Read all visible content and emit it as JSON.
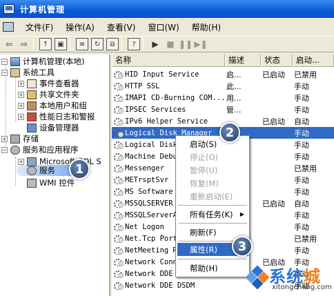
{
  "window": {
    "title": "计算机管理"
  },
  "menu": [
    "文件(F)",
    "操作(A)",
    "查看(V)",
    "窗口(W)",
    "帮助(H)"
  ],
  "tree": {
    "root": "计算机管理(本地)",
    "system_tools": "系统工具",
    "event_viewer": "事件查看器",
    "shared_folders": "共享文件夹",
    "local_users": "本地用户和组",
    "perf_logs": "性能日志和警报",
    "device_manager": "设备管理器",
    "storage": "存储",
    "services_apps": "服务和应用程序",
    "sql": "Microsoft SQL S",
    "services": "服务",
    "wmi": "WMI 控件"
  },
  "columns": [
    "名称",
    "描述",
    "状态",
    "启动..."
  ],
  "services": [
    {
      "name": "HID Input Service",
      "desc": "启...",
      "status": "已启动",
      "start": "已禁用"
    },
    {
      "name": "HTTP SSL",
      "desc": "此...",
      "status": "",
      "start": "手动"
    },
    {
      "name": "IMAPI CD-Burning COM...",
      "desc": "用...",
      "status": "",
      "start": "手动"
    },
    {
      "name": "IPSEC Services",
      "desc": "管...",
      "status": "",
      "start": "手动"
    },
    {
      "name": "IPv6 Helper Service",
      "desc": "...",
      "status": "已启动",
      "start": "自动"
    },
    {
      "name": "Logical Disk Manager",
      "desc": "",
      "status": "",
      "start": "手动"
    },
    {
      "name": "Logical Disk",
      "desc": "",
      "status": "",
      "start": "手动"
    },
    {
      "name": "Machine Debu",
      "desc": "",
      "status": "",
      "start": "手动"
    },
    {
      "name": "Messenger",
      "desc": "",
      "status": "",
      "start": "已禁用"
    },
    {
      "name": "METrsptSvr",
      "desc": "",
      "status": "",
      "start": "手动"
    },
    {
      "name": "MS Software",
      "desc": "",
      "status": "",
      "start": "手动"
    },
    {
      "name": "MSSQLSERVER",
      "desc": "",
      "status": "已启动",
      "start": "自动"
    },
    {
      "name": "MSSQLServerA",
      "desc": "",
      "status": "",
      "start": "手动"
    },
    {
      "name": "Net Logon",
      "desc": "",
      "status": "",
      "start": "手动"
    },
    {
      "name": "Net.Tcp Port",
      "desc": "",
      "status": "",
      "start": "已禁用"
    },
    {
      "name": "NetMeeting R",
      "desc": "",
      "status": "",
      "start": "手动"
    },
    {
      "name": "Network Conn",
      "desc": "",
      "status": "已启动",
      "start": "手动"
    },
    {
      "name": "Network DDE",
      "desc": "",
      "status": "",
      "start": "手动"
    },
    {
      "name": "Network DDE DSDM",
      "desc": "",
      "status": "",
      "start": "手动"
    }
  ],
  "context_menu": {
    "start": "启动(S)",
    "stop": "停止(O)",
    "pause": "暂停(U)",
    "resume": "恢复(M)",
    "restart": "重新启动(E)",
    "all_tasks": "所有任务(K)",
    "refresh": "刷新(F)",
    "properties": "属性(R)",
    "help": "帮助(H)"
  },
  "steps": [
    "1",
    "2",
    "3"
  ],
  "watermark": {
    "brand": "系统城",
    "url": "xitongcheng.com"
  },
  "colors": {
    "title_bar": "#0a58d8",
    "selection": "#316ac5",
    "brand_blue": "#2a74d0",
    "brand_orange": "#f08020"
  }
}
